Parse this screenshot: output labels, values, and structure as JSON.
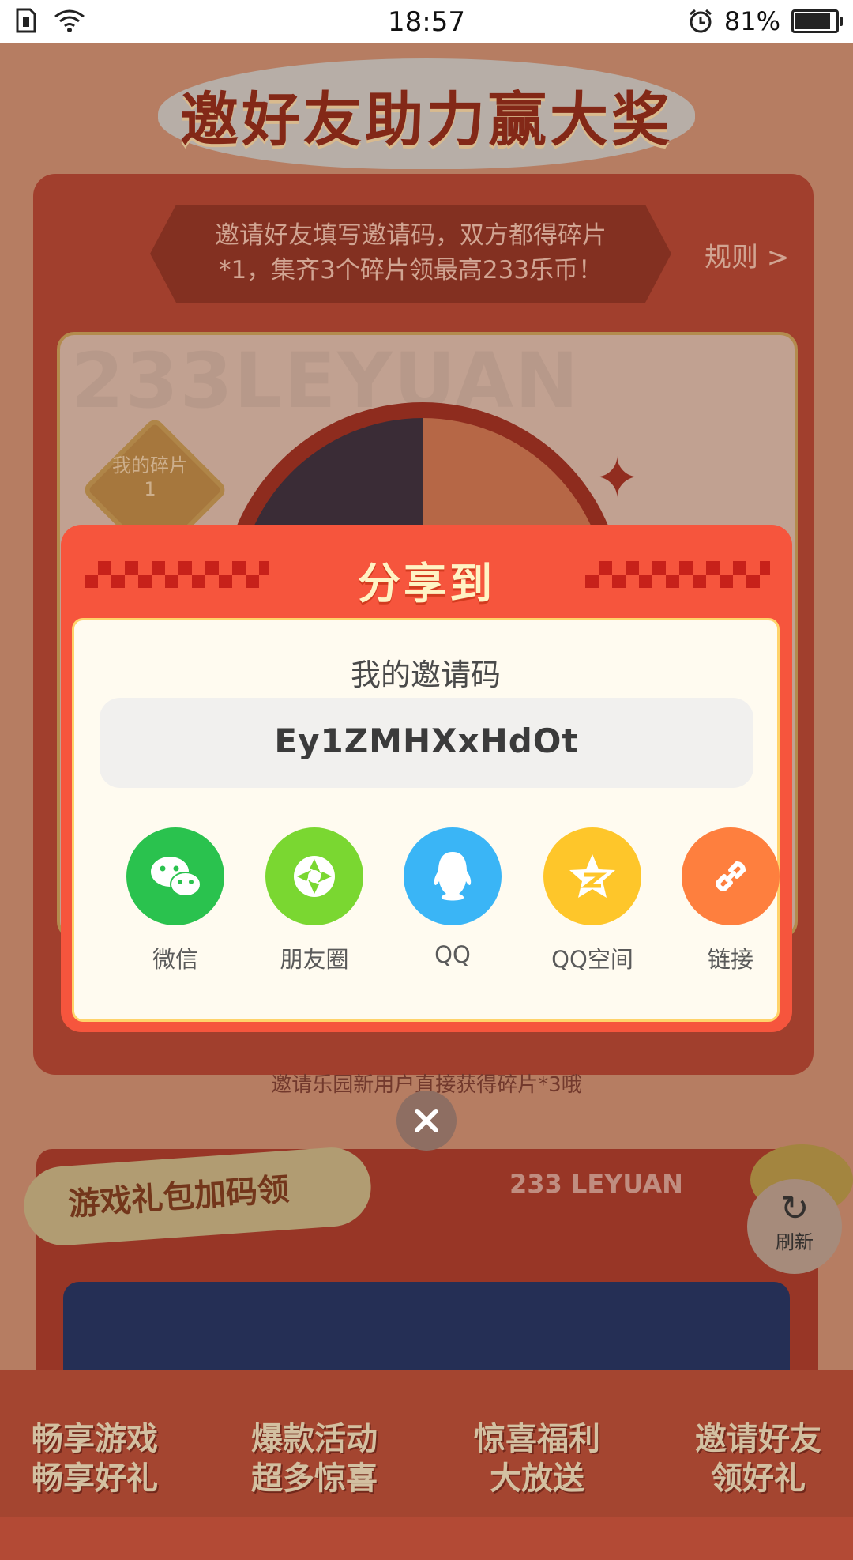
{
  "status_bar": {
    "time": "18:57",
    "battery_percent": "81%",
    "battery_level": 0.81
  },
  "background": {
    "title": "邀好友助力赢大奖",
    "banner_line1": "邀请好友填写邀请码，双方都得碎片",
    "banner_line2": "*1，集齐3个碎片领最高233乐币！",
    "rules": "规则 >",
    "watermark": "233LEYUAN",
    "fragment_label": "我的碎片",
    "fragment_count": "1",
    "invite_note": "邀请乐园新用户直接获得碎片*3哦",
    "gift_section_title": "游戏礼包加码领",
    "brand_text": "233 LEYUAN",
    "refresh_label": "刷新",
    "bottom_tags": [
      {
        "line1": "畅享游戏",
        "line2": "畅享好礼"
      },
      {
        "line1": "爆款活动",
        "line2": "超多惊喜"
      },
      {
        "line1": "惊喜福利",
        "line2": "大放送"
      },
      {
        "line1": "邀请好友",
        "line2": "领好礼"
      }
    ]
  },
  "dialog": {
    "title": "分享到",
    "invite_code_label": "我的邀请码",
    "invite_code": "Ey1ZMHXxHdOt",
    "share_targets": [
      {
        "label": "微信",
        "icon": "wechat-icon",
        "color": "#2ac24e"
      },
      {
        "label": "朋友圈",
        "icon": "moments-icon",
        "color": "#7ad731"
      },
      {
        "label": "QQ",
        "icon": "qq-icon",
        "color": "#3ab5f6"
      },
      {
        "label": "QQ空间",
        "icon": "qzone-icon",
        "color": "#fec62a"
      },
      {
        "label": "链接",
        "icon": "link-icon",
        "color": "#fe7f3e"
      }
    ]
  },
  "colors": {
    "dialog_red": "#f6553d",
    "dialog_body": "#fffbf0",
    "title_yellow": "#fff3c4"
  }
}
